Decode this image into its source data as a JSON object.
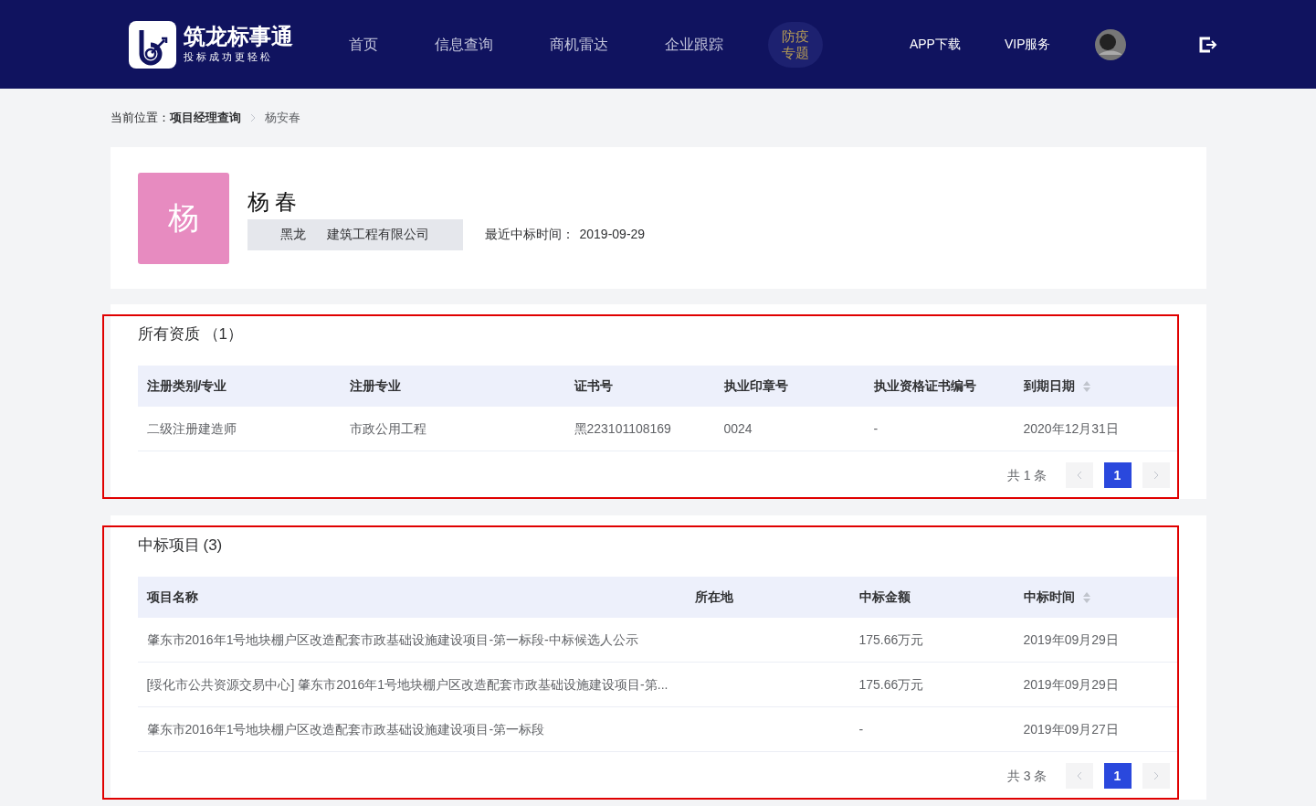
{
  "header": {
    "logo": {
      "title": "筑龙标事通",
      "slogan": "投标成功更轻松"
    },
    "nav": [
      {
        "label": "首页",
        "kind": "link"
      },
      {
        "label": "信息查询",
        "kind": "link"
      },
      {
        "label": "商机雷达",
        "kind": "link"
      },
      {
        "label": "企业跟踪",
        "kind": "link"
      },
      {
        "label": "防疫专题",
        "kind": "special"
      }
    ],
    "actions": [
      "APP下载",
      "VIP服务"
    ]
  },
  "breadcrumb": {
    "prefix": "当前位置：",
    "items": [
      {
        "label": "项目经理查询",
        "current": false
      },
      {
        "label": "杨安春",
        "current": true
      }
    ]
  },
  "profile": {
    "avatar_char": "杨",
    "name": "杨 春",
    "company": "黑龙      建筑工程有限公司",
    "last_win_label": "最近中标时间：",
    "last_win_date": "2019-09-29"
  },
  "sections": [
    {
      "title": "所有资质",
      "count": "（1）",
      "highlighted": true,
      "columns": [
        {
          "label": "注册类别/专业",
          "sortable": false
        },
        {
          "label": "注册专业",
          "sortable": false
        },
        {
          "label": "证书号",
          "sortable": false
        },
        {
          "label": "执业印章号",
          "sortable": false
        },
        {
          "label": "执业资格证书编号",
          "sortable": false
        },
        {
          "label": "到期日期",
          "sortable": true
        }
      ],
      "rows": [
        [
          "二级注册建造师",
          "市政公用工程",
          "黑223101108169",
          "0024",
          "-",
          "2020年12月31日"
        ]
      ],
      "pagination": {
        "total": "共 1 条",
        "pages": [
          {
            "label": "1",
            "selected": true
          }
        ],
        "prev_disabled": true,
        "next_disabled": true
      }
    },
    {
      "title": "中标项目",
      "count": "(3)",
      "highlighted": true,
      "columns": [
        {
          "label": "项目名称",
          "sortable": false
        },
        {
          "label": "所在地",
          "sortable": false
        },
        {
          "label": "中标金额",
          "sortable": false
        },
        {
          "label": "中标时间",
          "sortable": true
        }
      ],
      "rows": [
        [
          "肇东市2016年1号地块棚户区改造配套市政基础设施建设项目-第一标段-中标候选人公示",
          "",
          "175.66万元",
          "2019年09月29日"
        ],
        [
          "[绥化市公共资源交易中心] 肇东市2016年1号地块棚户区改造配套市政基础设施建设项目-第...",
          "",
          "175.66万元",
          "2019年09月29日"
        ],
        [
          "肇东市2016年1号地块棚户区改造配套市政基础设施建设项目-第一标段",
          "",
          "-",
          "2019年09月27日"
        ]
      ],
      "pagination": {
        "total": "共 3 条",
        "pages": [
          {
            "label": "1",
            "selected": true
          }
        ],
        "prev_disabled": true,
        "next_disabled": true
      }
    }
  ]
}
